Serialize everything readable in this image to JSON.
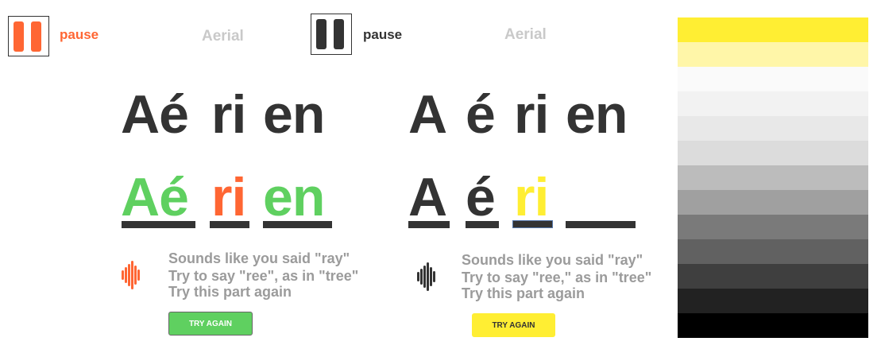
{
  "colors": {
    "orange": "#ff6633",
    "green": "#5fd060",
    "yellow": "#ffee33",
    "dark": "#333333",
    "gray_text": "#9b9b9b",
    "light_gray": "#c9c9c9"
  },
  "left": {
    "pause_label": "pause",
    "word_label": "Aerial",
    "syllables_plain": [
      "Aé",
      "ri",
      "en"
    ],
    "syllables_scored": [
      "Aé",
      "ri",
      "en"
    ],
    "feedback": {
      "line1": "Sounds like you said \"ray\"",
      "line2": "Try to say \"ree\", as in \"tree\"",
      "line3": "Try this part again"
    },
    "button_label": "TRY AGAIN",
    "icons": {
      "pause": "pause-icon",
      "wave": "sound-wave-icon"
    }
  },
  "right": {
    "pause_label": "pause",
    "word_label": "Aerial",
    "syllables_plain": [
      "A",
      "é",
      "ri",
      "en"
    ],
    "syllables_scored": [
      "A",
      "é",
      "ri"
    ],
    "feedback": {
      "line1": "Sounds like you said \"ray\"",
      "line2": "Try to say \"ree,\" as in \"tree\"",
      "line3": "Try this part again"
    },
    "button_label": "TRY AGAIN",
    "icons": {
      "pause": "pause-icon",
      "wave": "sound-wave-icon"
    }
  },
  "palette": [
    "#ffee33",
    "#fff6a8",
    "#fafafa",
    "#f2f2f2",
    "#e8e8e8",
    "#dcdcdc",
    "#bcbcbc",
    "#a0a0a0",
    "#7a7a7a",
    "#616161",
    "#3f3f3f",
    "#222222",
    "#000000"
  ]
}
